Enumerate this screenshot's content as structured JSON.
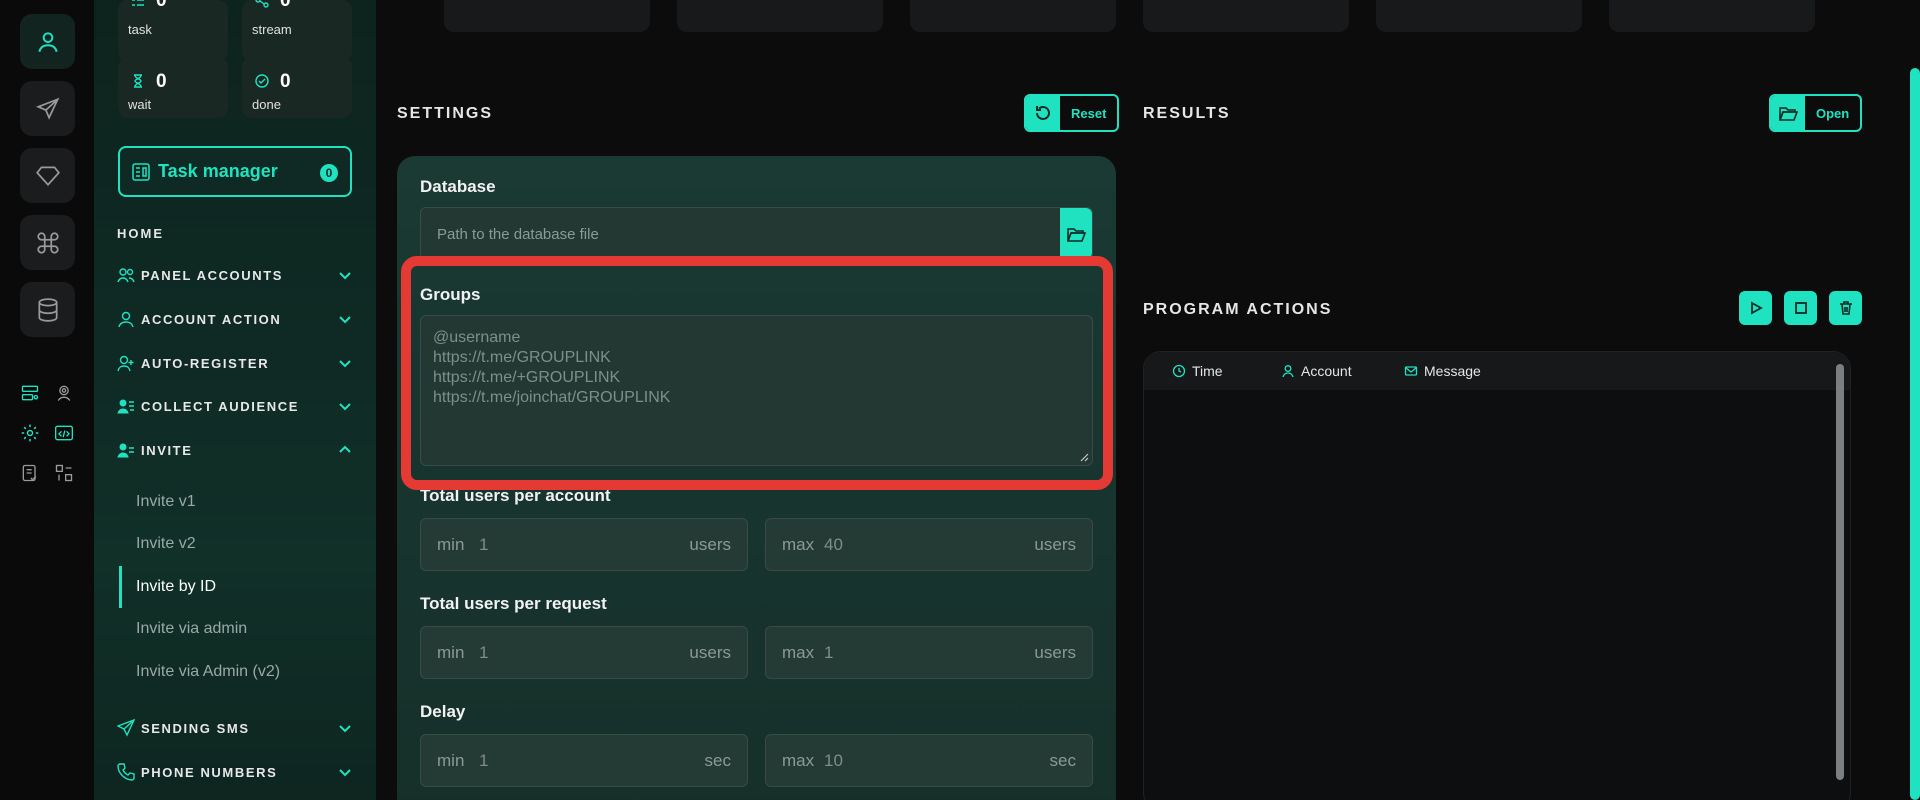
{
  "stats": [
    {
      "value": "0",
      "label": "task",
      "icon": "task-icon"
    },
    {
      "value": "0",
      "label": "stream",
      "icon": "stream-icon"
    },
    {
      "value": "0",
      "label": "wait",
      "icon": "hourglass-icon"
    },
    {
      "value": "0",
      "label": "done",
      "icon": "check-circle-icon"
    }
  ],
  "task_manager": {
    "label": "Task manager",
    "count": "0"
  },
  "nav": {
    "home": "HOME",
    "sections": [
      {
        "label": "PANEL ACCOUNTS",
        "icon": "users-icon",
        "expanded": false
      },
      {
        "label": "ACCOUNT ACTION",
        "icon": "user-icon",
        "expanded": false
      },
      {
        "label": "AUTO-REGISTER",
        "icon": "user-plus-icon",
        "expanded": false
      },
      {
        "label": "COLLECT AUDIENCE",
        "icon": "user-list-icon",
        "expanded": false
      },
      {
        "label": "INVITE",
        "icon": "user-invite-icon",
        "expanded": true
      },
      {
        "label": "SENDING SMS",
        "icon": "send-icon",
        "expanded": false
      },
      {
        "label": "PHONE NUMBERS",
        "icon": "phone-icon",
        "expanded": false
      }
    ],
    "invite_items": [
      "Invite v1",
      "Invite v2",
      "Invite by ID",
      "Invite via admin",
      "Invite via Admin (v2)"
    ],
    "active_item": "Invite by ID"
  },
  "settings": {
    "title": "SETTINGS",
    "reset_label": "Reset",
    "database": {
      "label": "Database",
      "placeholder": "Path to the database file"
    },
    "groups": {
      "label": "Groups",
      "placeholder_lines": [
        "@username",
        "https://t.me/GROUPLINK",
        "https://t.me/+GROUPLINK",
        "https://t.me/joinchat/GROUPLINK"
      ]
    },
    "total_per_account": {
      "label": "Total users per account",
      "min_prefix": "min",
      "min": "1",
      "max_prefix": "max",
      "max": "40",
      "unit": "users"
    },
    "total_per_request": {
      "label": "Total users per request",
      "min_prefix": "min",
      "min": "1",
      "max_prefix": "max",
      "max": "1",
      "unit": "users"
    },
    "delay": {
      "label": "Delay",
      "min_prefix": "min",
      "min": "1",
      "max_prefix": "max",
      "max": "10",
      "unit": "sec"
    }
  },
  "results": {
    "title": "RESULTS",
    "open_label": "Open"
  },
  "program_actions": {
    "title": "PROGRAM ACTIONS",
    "columns": [
      {
        "label": "Time",
        "icon": "clock-icon"
      },
      {
        "label": "Account",
        "icon": "user-icon"
      },
      {
        "label": "Message",
        "icon": "mail-icon"
      }
    ]
  },
  "colors": {
    "accent": "#1fe3c0",
    "highlight": "#e53a33",
    "background": "#0c0c0d"
  }
}
